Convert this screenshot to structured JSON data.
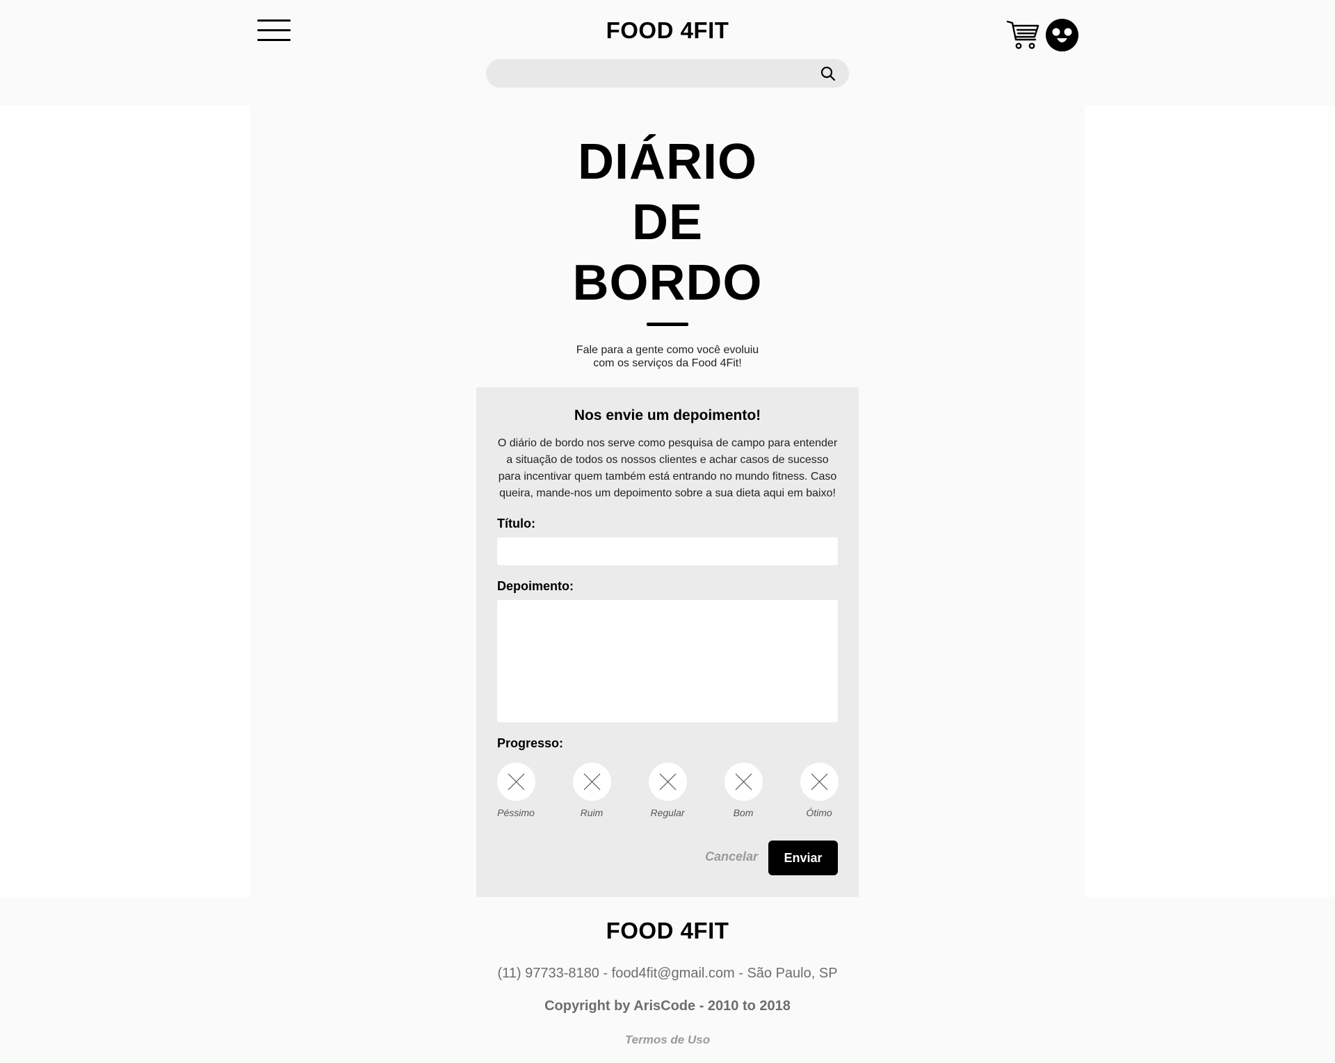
{
  "header": {
    "brand": "FOOD 4FIT",
    "menu_icon": "hamburger-menu-icon",
    "cart_icon": "shopping-cart-icon",
    "avatar_icon": "user-avatar-icon",
    "search": {
      "value": "",
      "placeholder": "",
      "icon": "search-icon"
    }
  },
  "main": {
    "title_lines": [
      "DIÁRIO",
      "DE",
      "BORDO"
    ],
    "subtitle_lines": [
      "Fale para a gente como você evoluiu",
      "com os serviços da Food 4Fit!"
    ]
  },
  "form": {
    "heading": "Nos envie um depoimento!",
    "description_lines": [
      "O diário de bordo nos serve como pesquisa de campo para entender",
      "a situação de todos os nossos clientes e achar casos de sucesso",
      "para incentivar quem também está entrando no mundo fitness. Caso",
      "queira, mande-nos um depoimento sobre a sua dieta aqui em baixo!"
    ],
    "title_label": "Título:",
    "title_value": "",
    "testimony_label": "Depoimento:",
    "testimony_value": "",
    "progress_label": "Progresso:",
    "progress_options": [
      {
        "label": "Péssimo",
        "icon": "x-icon"
      },
      {
        "label": "Ruim",
        "icon": "x-icon"
      },
      {
        "label": "Regular",
        "icon": "x-icon"
      },
      {
        "label": "Bom",
        "icon": "x-icon"
      },
      {
        "label": "Ótimo",
        "icon": "x-icon"
      }
    ],
    "cancel_label": "Cancelar",
    "submit_label": "Enviar"
  },
  "footer": {
    "brand": "FOOD 4FIT",
    "contact": "(11) 97733-8180 - food4fit@gmail.com - São Paulo, SP",
    "copyright": "Copyright by ArisCode - 2010 to 2018",
    "terms_label": "Termos de Uso"
  },
  "colors": {
    "background": "#fafafa",
    "card": "#ebebeb",
    "input": "#ffffff",
    "primary_button": "#000000",
    "muted_text": "#6d6d6d"
  }
}
